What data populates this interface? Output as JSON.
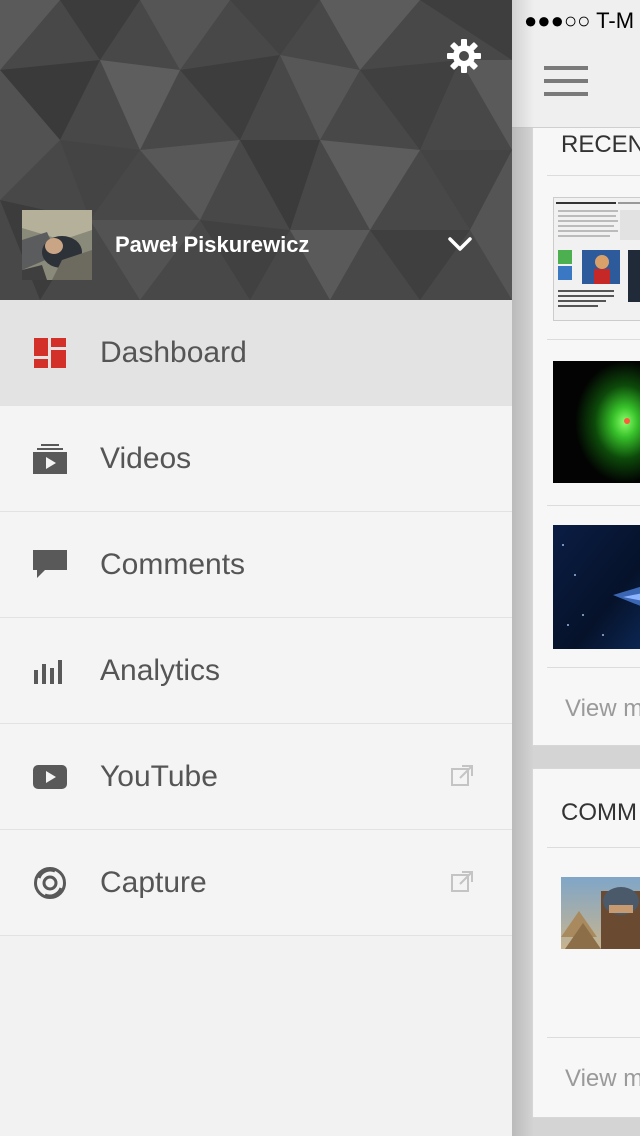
{
  "status_bar": {
    "carrier": "●●●○○ T-M"
  },
  "drawer": {
    "user": {
      "name": "Paweł Piskurewicz"
    },
    "icons": {
      "settings": "gear-icon",
      "account_switch": "chevron-down-icon"
    },
    "menu": [
      {
        "label": "Dashboard",
        "icon": "dashboard-icon",
        "active": true,
        "external": false
      },
      {
        "label": "Videos",
        "icon": "videos-icon",
        "active": false,
        "external": false
      },
      {
        "label": "Comments",
        "icon": "comment-icon",
        "active": false,
        "external": false
      },
      {
        "label": "Analytics",
        "icon": "analytics-icon",
        "active": false,
        "external": false
      },
      {
        "label": "YouTube",
        "icon": "youtube-icon",
        "active": false,
        "external": true
      },
      {
        "label": "Capture",
        "icon": "capture-icon",
        "active": false,
        "external": true
      }
    ]
  },
  "main": {
    "recent_title": "RECEN",
    "comments_title": "COMM",
    "view_more": "View m"
  },
  "colors": {
    "accent": "#d4302a",
    "icon_gray": "#595959",
    "header_bg": "#4a4a4a",
    "active_item_bg": "#e3e3e3"
  }
}
